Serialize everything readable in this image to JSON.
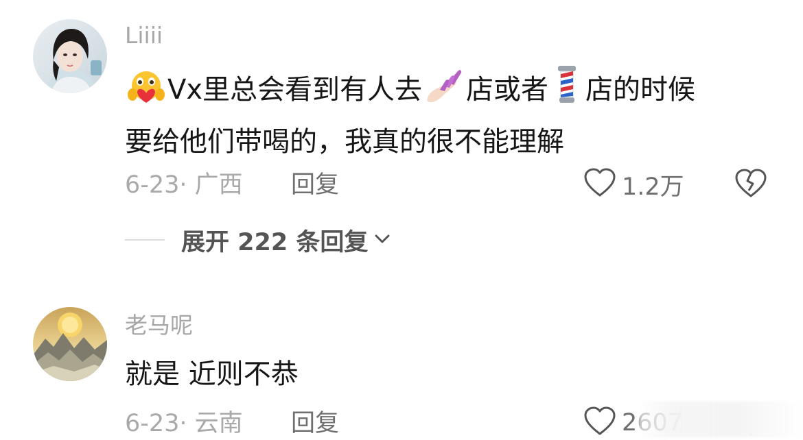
{
  "comments": [
    {
      "username": "Liiii",
      "content_parts": [
        "Vx里总会看到有人去",
        "店或者",
        "店的时候"
      ],
      "content_line2": "要给他们带喝的，我真的很不能理解",
      "emojis": [
        "hugging-face-emoji",
        "nail-polish-emoji",
        "barber-pole-emoji"
      ],
      "meta": "6-23· 广西",
      "reply_label": "回复",
      "like_count": "1.2万",
      "expand_label": "展开 222 条回复"
    },
    {
      "username": "老马呢",
      "content": "就是  近则不恭",
      "meta": "6-23· 云南",
      "reply_label": "回复",
      "like_count": "2607"
    }
  ],
  "colors": {
    "username": "#a7a7a7",
    "content": "#161616",
    "meta": "#a9a9a9",
    "action": "#6f6f6f",
    "expand": "#545454"
  },
  "icons": [
    "heart-outline-icon",
    "broken-heart-icon",
    "chevron-down-icon"
  ]
}
